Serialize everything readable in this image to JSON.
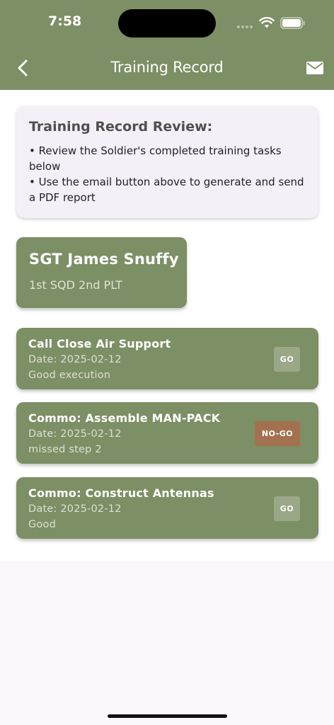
{
  "status_bar": {
    "time": "7:58"
  },
  "header": {
    "title": "Training Record",
    "back_icon": "chevron-left-icon",
    "email_icon": "envelope-icon",
    "background": "#7d8f64"
  },
  "info": {
    "title": "Training Record Review:",
    "lines": [
      "• Review the Soldier's completed training tasks below",
      "• Use the email button above to generate and send a PDF report"
    ]
  },
  "soldier": {
    "name": "SGT James Snuffy",
    "unit": "1st SQD 2nd PLT"
  },
  "tasks": [
    {
      "title": "Call Close Air Support",
      "date": "Date: 2025-02-12",
      "note": "Good execution",
      "status": "GO"
    },
    {
      "title": "Commo: Assemble MAN-PACK",
      "date": "Date: 2025-02-12",
      "note": "missed step 2",
      "status": "NO-GO"
    },
    {
      "title": "Commo: Construct Antennas",
      "date": "Date: 2025-02-12",
      "note": "Good",
      "status": "GO"
    }
  ],
  "colors": {
    "accent": "#7d8f64",
    "go_badge": "#9aa888",
    "nogo_badge": "#a3714f",
    "info_card": "#f5f0f7"
  }
}
